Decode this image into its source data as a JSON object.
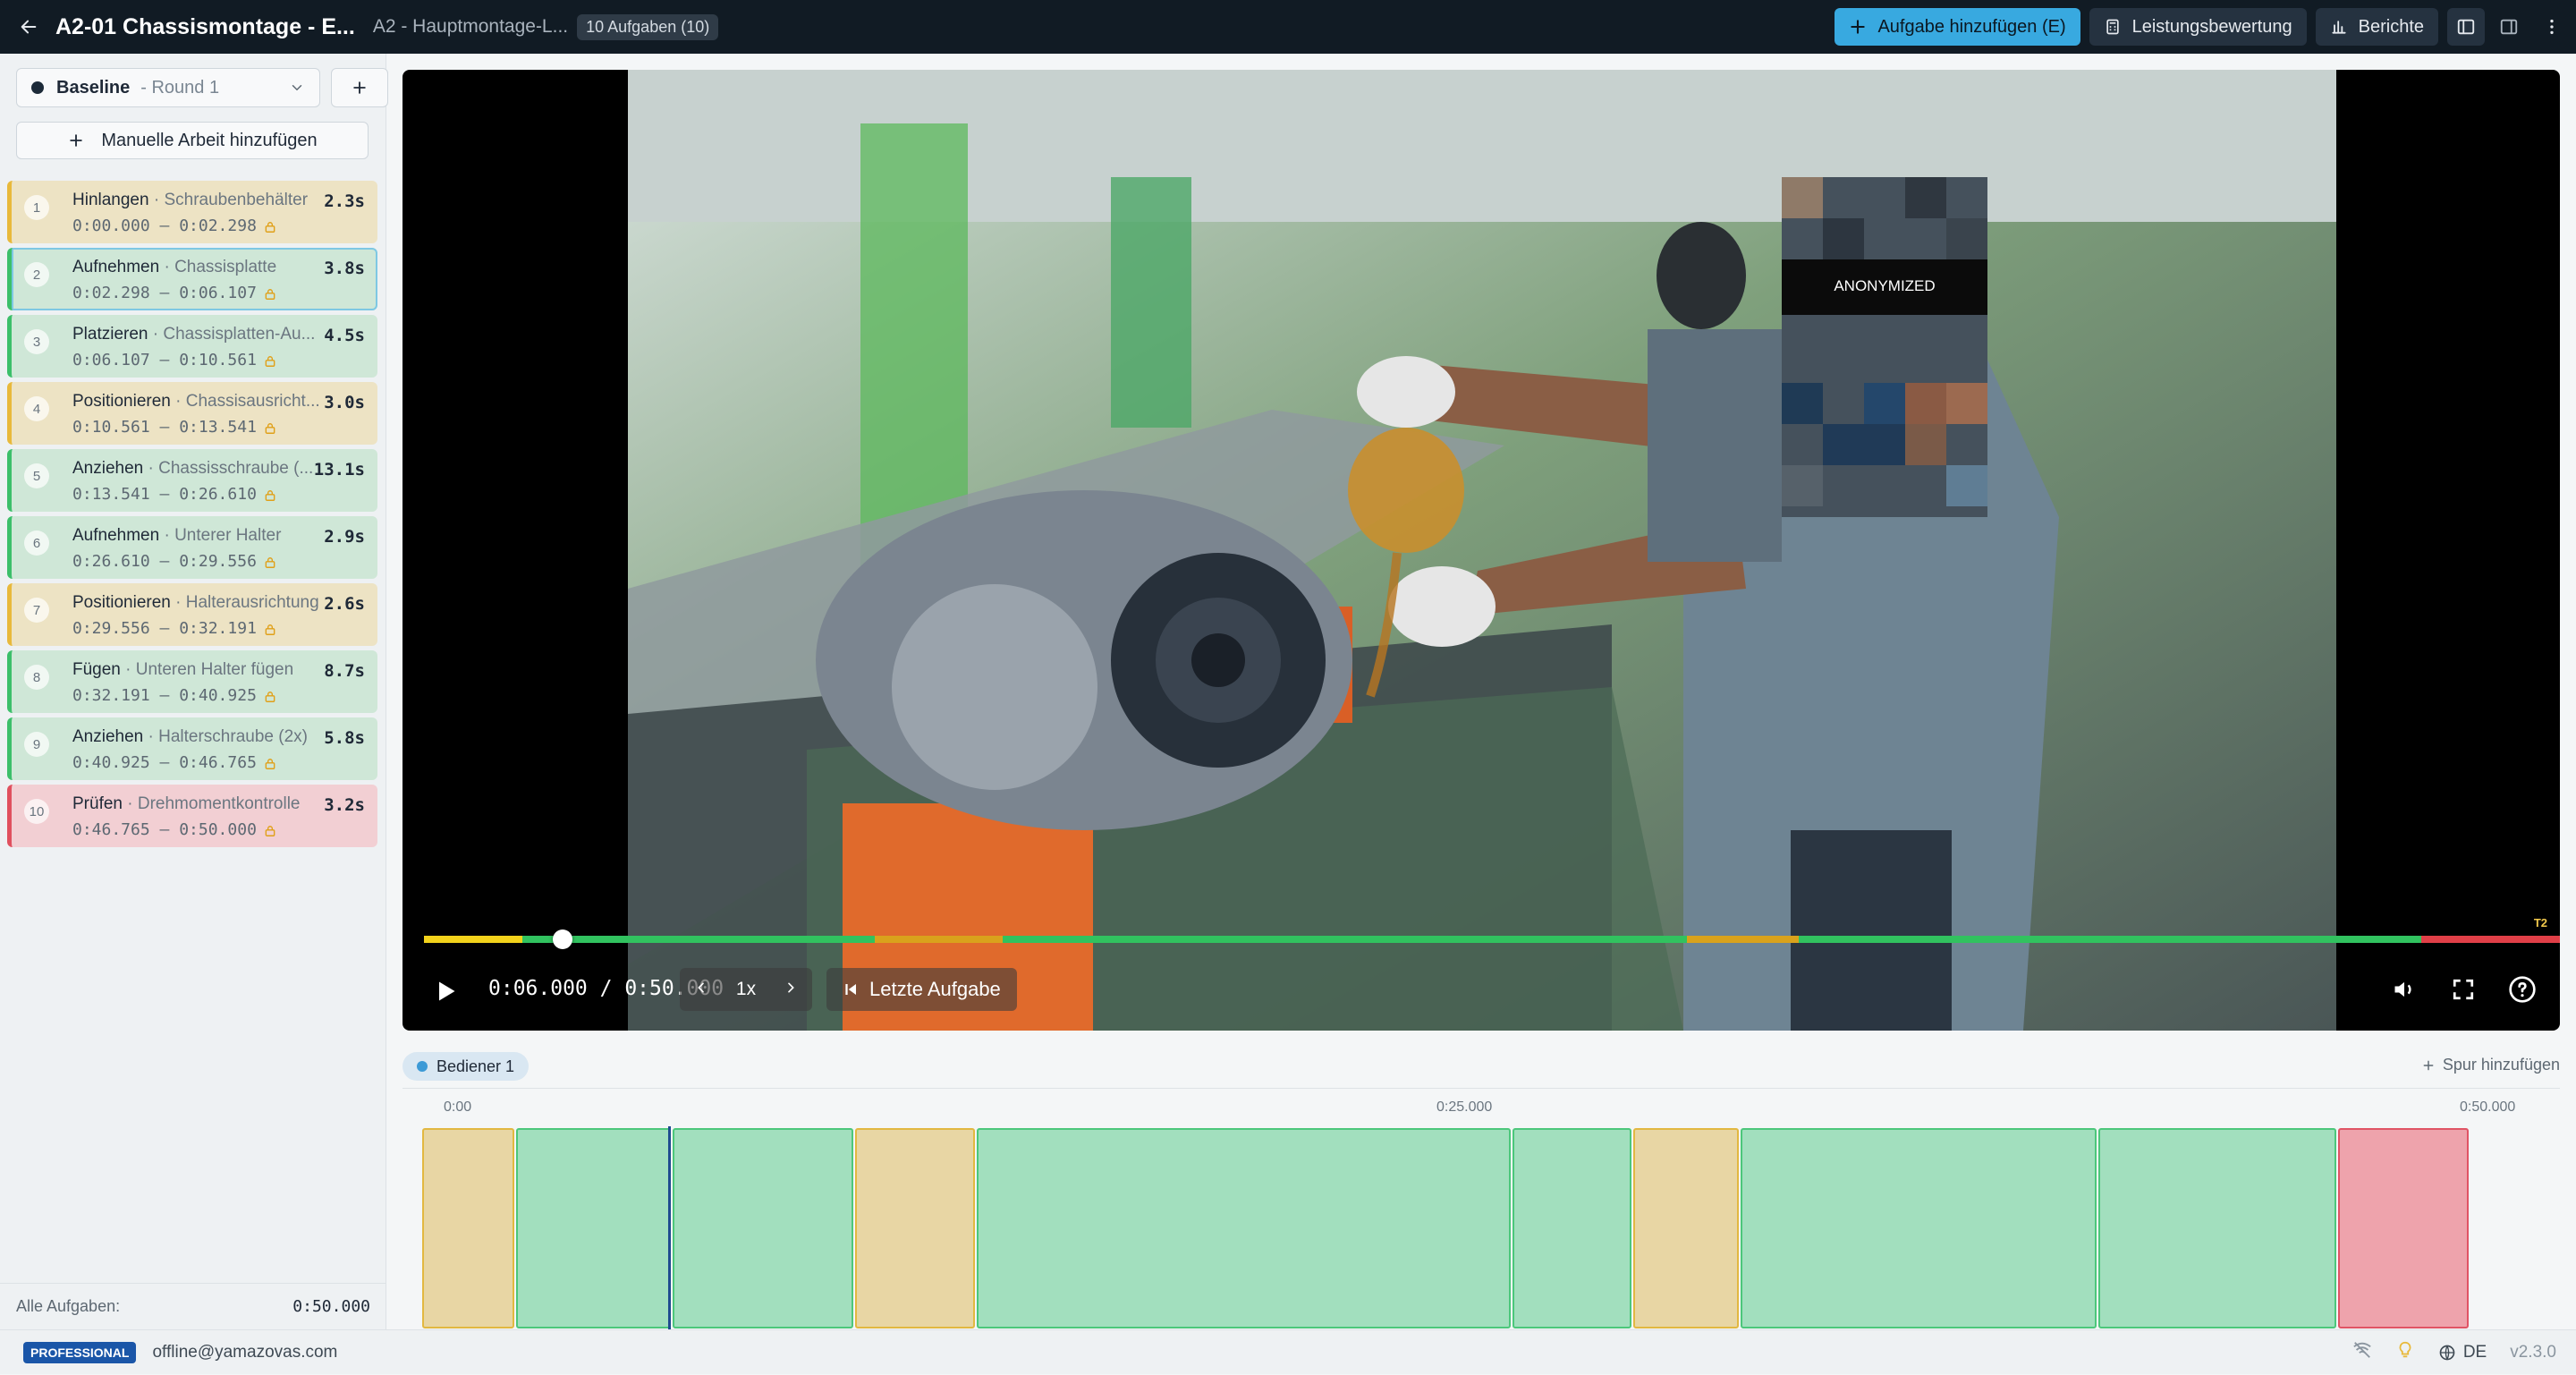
{
  "header": {
    "title": "A2-01 Chassismontage - E...",
    "subtitle": "A2 - Hauptmontage-L...",
    "task_count_badge": "10 Aufgaben (10)",
    "add_task_label": "Aufgabe hinzufügen (E)",
    "performance_label": "Leistungsbewertung",
    "reports_label": "Berichte"
  },
  "sidebar": {
    "round_name": "Baseline",
    "round_label": "- Round 1",
    "manual_work_label": "Manuelle Arbeit hinzufügen",
    "tasks": [
      {
        "num": "1",
        "action": "Hinlangen",
        "object": "· Schraubenbehälter",
        "range": "0:00.000 — 0:02.298",
        "duration": "2.3s",
        "color": "yellow"
      },
      {
        "num": "2",
        "action": "Aufnehmen",
        "object": "· Chassisplatte",
        "range": "0:02.298 — 0:06.107",
        "duration": "3.8s",
        "color": "green"
      },
      {
        "num": "3",
        "action": "Platzieren",
        "object": "· Chassisplatten-Au...",
        "range": "0:06.107 — 0:10.561",
        "duration": "4.5s",
        "color": "green"
      },
      {
        "num": "4",
        "action": "Positionieren",
        "object": "· Chassisausricht...",
        "range": "0:10.561 — 0:13.541",
        "duration": "3.0s",
        "color": "yellow"
      },
      {
        "num": "5",
        "action": "Anziehen",
        "object": "· Chassisschraube (...",
        "range": "0:13.541 — 0:26.610",
        "duration": "13.1s",
        "color": "green"
      },
      {
        "num": "6",
        "action": "Aufnehmen",
        "object": "· Unterer Halter",
        "range": "0:26.610 — 0:29.556",
        "duration": "2.9s",
        "color": "green"
      },
      {
        "num": "7",
        "action": "Positionieren",
        "object": "· Halterausrichtung",
        "range": "0:29.556 — 0:32.191",
        "duration": "2.6s",
        "color": "yellow"
      },
      {
        "num": "8",
        "action": "Fügen",
        "object": "· Unteren Halter fügen",
        "range": "0:32.191 — 0:40.925",
        "duration": "8.7s",
        "color": "green"
      },
      {
        "num": "9",
        "action": "Anziehen",
        "object": "· Halterschraube (2x)",
        "range": "0:40.925 — 0:46.765",
        "duration": "5.8s",
        "color": "green"
      },
      {
        "num": "10",
        "action": "Prüfen",
        "object": "· Drehmomentkontrolle",
        "range": "0:46.765 — 0:50.000",
        "duration": "3.2s",
        "color": "red"
      }
    ],
    "footer_label": "Alle Aufgaben:",
    "footer_total": "0:50.000"
  },
  "video": {
    "anonymized_label": "ANONYMIZED",
    "current_time": "0:06.000",
    "total_time": "0:50.000",
    "time_display": "0:06.000 / 0:50.000",
    "speed": "1x",
    "last_task_label": "Letzte Aufgabe",
    "end_marker": "T2",
    "progress_fraction": 0.12,
    "segments": [
      {
        "start": 0,
        "end": 2.298,
        "color": "#f2d21b"
      },
      {
        "start": 2.298,
        "end": 6.107,
        "color": "#31c25f"
      },
      {
        "start": 6.107,
        "end": 10.561,
        "color": "#31c25f"
      },
      {
        "start": 10.561,
        "end": 13.541,
        "color": "#d9a21c"
      },
      {
        "start": 13.541,
        "end": 26.61,
        "color": "#31c25f"
      },
      {
        "start": 26.61,
        "end": 29.556,
        "color": "#31c25f"
      },
      {
        "start": 29.556,
        "end": 32.191,
        "color": "#d9a21c"
      },
      {
        "start": 32.191,
        "end": 40.925,
        "color": "#31c25f"
      },
      {
        "start": 40.925,
        "end": 46.765,
        "color": "#31c25f"
      },
      {
        "start": 46.765,
        "end": 50.0,
        "color": "#e03f47"
      }
    ]
  },
  "timeline": {
    "operator_label": "Bediener 1",
    "add_track_label": "Spur hinzufügen",
    "ticks": [
      "0:00",
      "0:25.000",
      "0:50.000"
    ]
  },
  "statusbar": {
    "plan": "PROFESSIONAL",
    "email": "offline@yamazovas.com",
    "language": "DE",
    "version": "v2.3.0"
  },
  "colors": {
    "accent": "#38a9e0",
    "topbar": "#111b24",
    "task_yellow": "#ede3c4",
    "task_green": "#cfe7d7",
    "task_red": "#f2cfd3"
  }
}
